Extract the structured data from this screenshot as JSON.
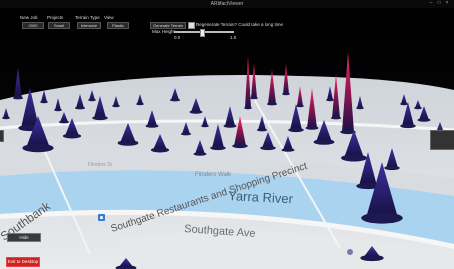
{
  "window": {
    "title": "ARtifactViewer"
  },
  "menu": {
    "headers": [
      "New Job",
      "Projects",
      "Terrain Type",
      "View"
    ],
    "values": [
      "2000",
      "Small",
      "Intensive",
      "Plastic"
    ]
  },
  "controls": {
    "generate_label": "Generate Terrain",
    "regen_label": "Regenerate Terrain? Could take a long time",
    "max_height_label": "Max Height",
    "max_height_left": "0.0",
    "max_height_right": "1.0",
    "max_height_value": 0.45
  },
  "map": {
    "river_label": "Yarra River",
    "streets": [
      "Southgate Ave",
      "Flinders Walk",
      "Flinders St"
    ],
    "places": [
      "Southgate Restaurants and Shopping Precinct",
      "Southbank"
    ]
  },
  "bottom": {
    "hide_label": "Hide",
    "exit_label": "Exit to Desktop"
  },
  "colors": {
    "spike": "#24206a",
    "spike_high": "#c01650",
    "river": "#aad3f0",
    "map_base": "#eef0f2"
  }
}
